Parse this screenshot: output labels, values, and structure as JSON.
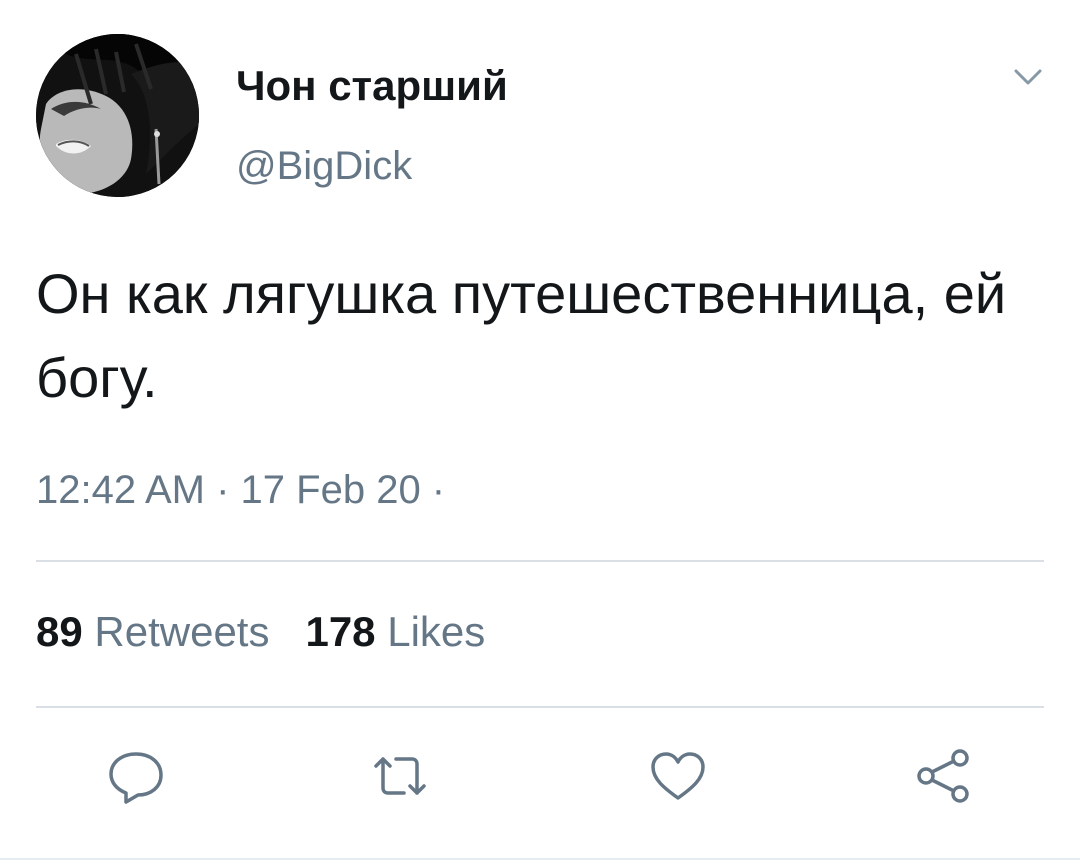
{
  "author": {
    "display_name": "Чон старший",
    "handle": "@BigDick"
  },
  "tweet": {
    "text": "Он как лягушка путешественница, ей богу.",
    "timestamp": "12:42 AM · 17 Feb 20 ·"
  },
  "stats": {
    "retweets_count": "89",
    "retweets_label": "Retweets",
    "likes_count": "178",
    "likes_label": "Likes"
  },
  "icons": {
    "menu": "chevron-down-icon",
    "reply": "reply-icon",
    "retweet": "retweet-icon",
    "like": "heart-icon",
    "share": "share-icon"
  },
  "colors": {
    "text_primary": "#14171a",
    "text_secondary": "#657786",
    "divider": "#d9dfe4"
  }
}
